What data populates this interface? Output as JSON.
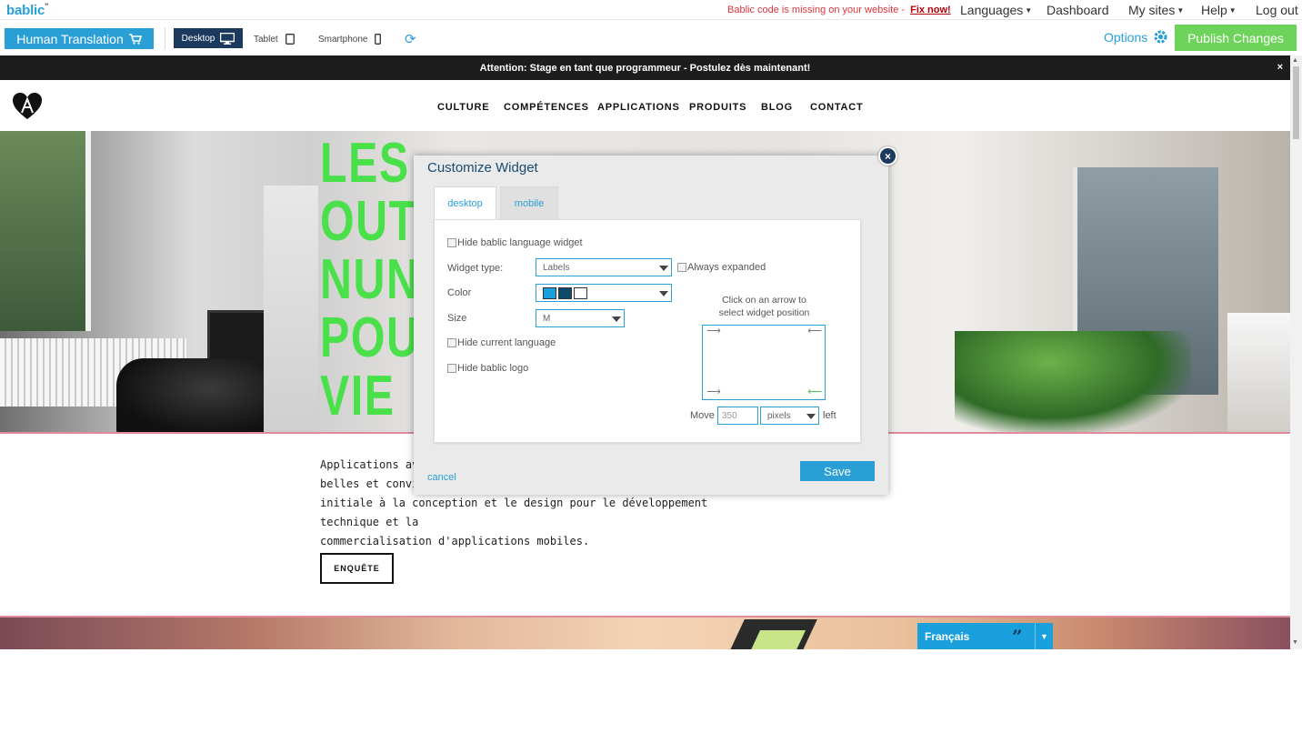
{
  "app": {
    "logo": "bablic",
    "logo_mark": "\""
  },
  "topbar": {
    "warning": "Bablic code is missing on your website -",
    "fix_link": "Fix now!",
    "nav": [
      {
        "label": "Languages",
        "dropdown": true
      },
      {
        "label": "Dashboard",
        "dropdown": false
      },
      {
        "label": "My sites",
        "dropdown": true
      },
      {
        "label": "Help",
        "dropdown": true
      },
      {
        "label": "Log out",
        "dropdown": false
      }
    ]
  },
  "toolbar": {
    "human_translation": "Human Translation",
    "devices": {
      "desktop": "Desktop",
      "tablet": "Tablet",
      "smartphone": "Smartphone"
    },
    "options": "Options",
    "publish": "Publish Changes"
  },
  "site": {
    "attention": "Attention: Stage en tant que programmeur - Postulez dès maintenant!",
    "attention_close": "×",
    "nav": [
      "CULTURE",
      "COMPÉTENCES",
      "APPLICATIONS",
      "PRODUITS",
      "BLOG",
      "CONTACT"
    ],
    "hero_words": [
      "LES",
      "OUT",
      "NUN",
      "POU",
      "VIE"
    ],
    "intro_lines": [
      "Applications ave",
      "belles et convivi",
      "initiale à la conception et le design pour le développement technique et la",
      "commercialisation d'applications mobiles."
    ],
    "cta": "ENQUÊTE",
    "lang_widget": {
      "label": "Français",
      "quote": "”"
    }
  },
  "modal": {
    "title": "Customize Widget",
    "close": "×",
    "tabs": {
      "desktop": "desktop",
      "mobile": "mobile"
    },
    "hide_widget": "Hide bablic language widget",
    "widget_type_label": "Widget type:",
    "widget_type_value": "Labels",
    "always_expanded": "Always expanded",
    "color_label": "Color",
    "colors": [
      "#1aa0dc",
      "#0e4a6a",
      "#ffffff"
    ],
    "size_label": "Size",
    "size_value": "M",
    "hide_current_language": "Hide current language",
    "hide_logo": "Hide bablic logo",
    "position_hint_1": "Click on an arrow to",
    "position_hint_2": "select widget position",
    "move_label": "Move",
    "move_value": "350",
    "move_unit": "pixels",
    "move_dir": "left",
    "cancel": "cancel",
    "save": "Save"
  }
}
